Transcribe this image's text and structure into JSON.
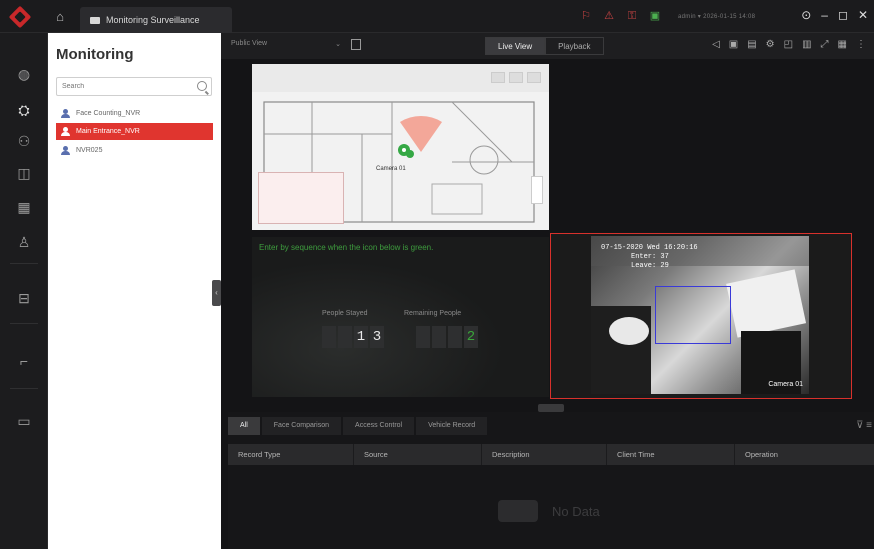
{
  "titlebar": {
    "tab_label": "Monitoring Surveillance",
    "user_info": "admin ▾  2026-01-15 14:08",
    "window_controls": [
      "⊙",
      "–",
      "◻",
      "✕"
    ]
  },
  "rail": {
    "items": [
      "globe-icon",
      "monitoring-icon",
      "people-icon",
      "layout-icon",
      "grid-icon",
      "user-icon",
      "door-icon",
      "camera-icon",
      "device-icon"
    ]
  },
  "panel": {
    "title": "Monitoring",
    "search_placeholder": "Search",
    "items": [
      {
        "label": "Face Counting_NVR"
      },
      {
        "label": "Main Entrance_NVR"
      },
      {
        "label": "NVR025"
      }
    ]
  },
  "toolbar": {
    "view_label": "Public View",
    "live_view": "Live View",
    "playback": "Playback"
  },
  "map_cell": {
    "camera_label": "Camera 01"
  },
  "counter_cell": {
    "hint": "Enter by sequence when the icon below is green.",
    "people_stayed_label": "People Stayed",
    "remaining_label": "Remaining People",
    "people_stayed_digits": [
      "",
      "",
      "1",
      "3"
    ],
    "remaining_digits": [
      "",
      "",
      "",
      "2"
    ]
  },
  "camera_cell": {
    "osd_line1": "07-15-2020 Wed 16:20:16",
    "osd_line2": "Enter: 37",
    "osd_line3": "Leave: 29",
    "camera_name": "Camera 01"
  },
  "events": {
    "tabs": [
      "All",
      "Face Comparison",
      "Access Control",
      "Vehicle Record"
    ],
    "columns": [
      "Record Type",
      "Source",
      "Description",
      "Client Time",
      "Operation"
    ],
    "empty_text": "No Data"
  }
}
